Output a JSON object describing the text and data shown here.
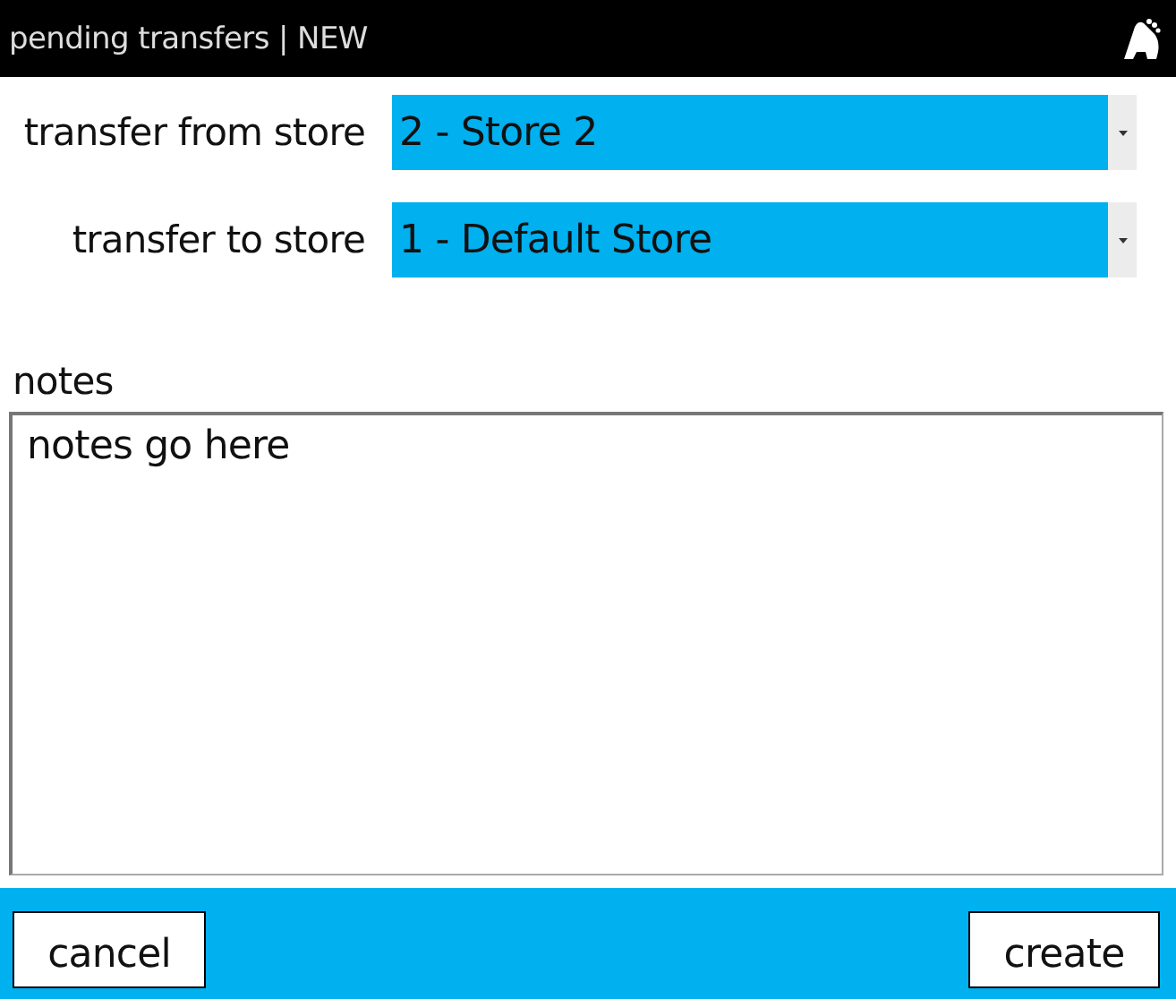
{
  "window": {
    "title": "pending transfers | NEW"
  },
  "fields": [
    {
      "label": "transfer from store",
      "value": "2 - Store 2"
    },
    {
      "label": "transfer to store",
      "value": "1 - Default Store"
    }
  ],
  "notes": {
    "label": "notes",
    "value": "notes go here"
  },
  "buttons": [
    "cancel",
    "create"
  ]
}
